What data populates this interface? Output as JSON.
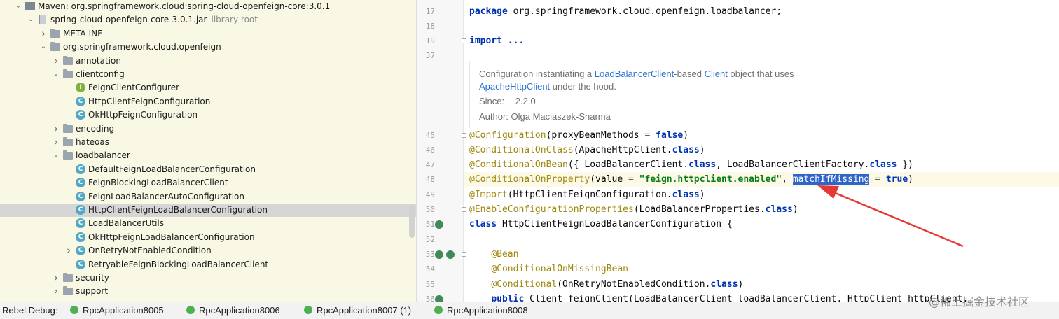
{
  "tree": {
    "rows": [
      {
        "label": "Maven: org.springframework.cloud:spring-cloud-openfeign-core:3.0.1",
        "hint": "",
        "icon": "maven",
        "arrow": "down",
        "level": 0
      },
      {
        "label": "spring-cloud-openfeign-core-3.0.1.jar",
        "hint": "library root",
        "icon": "jar",
        "arrow": "down",
        "level": 1
      },
      {
        "label": "META-INF",
        "hint": "",
        "icon": "folder",
        "arrow": "right",
        "level": 2
      },
      {
        "label": "org.springframework.cloud.openfeign",
        "hint": "",
        "icon": "folder",
        "arrow": "down",
        "level": 2
      },
      {
        "label": "annotation",
        "hint": "",
        "icon": "folder",
        "arrow": "right",
        "level": 3
      },
      {
        "label": "clientconfig",
        "hint": "",
        "icon": "folder",
        "arrow": "down",
        "level": 3
      },
      {
        "label": "FeignClientConfigurer",
        "hint": "",
        "icon": "interface",
        "arrow": "",
        "level": 4
      },
      {
        "label": "HttpClientFeignConfiguration",
        "hint": "",
        "icon": "class",
        "arrow": "",
        "level": 4
      },
      {
        "label": "OkHttpFeignConfiguration",
        "hint": "",
        "icon": "class",
        "arrow": "",
        "level": 4
      },
      {
        "label": "encoding",
        "hint": "",
        "icon": "folder",
        "arrow": "right",
        "level": 3
      },
      {
        "label": "hateoas",
        "hint": "",
        "icon": "folder",
        "arrow": "right",
        "level": 3
      },
      {
        "label": "loadbalancer",
        "hint": "",
        "icon": "folder",
        "arrow": "down",
        "level": 3
      },
      {
        "label": "DefaultFeignLoadBalancerConfiguration",
        "hint": "",
        "icon": "class",
        "arrow": "",
        "level": 4
      },
      {
        "label": "FeignBlockingLoadBalancerClient",
        "hint": "",
        "icon": "class",
        "arrow": "",
        "level": 4
      },
      {
        "label": "FeignLoadBalancerAutoConfiguration",
        "hint": "",
        "icon": "class",
        "arrow": "",
        "level": 4
      },
      {
        "label": "HttpClientFeignLoadBalancerConfiguration",
        "hint": "",
        "icon": "class",
        "arrow": "",
        "level": 4,
        "selected": true
      },
      {
        "label": "LoadBalancerUtils",
        "hint": "",
        "icon": "class",
        "arrow": "",
        "level": 4
      },
      {
        "label": "OkHttpFeignLoadBalancerConfiguration",
        "hint": "",
        "icon": "class",
        "arrow": "",
        "level": 4
      },
      {
        "label": "OnRetryNotEnabledCondition",
        "hint": "",
        "icon": "class",
        "arrow": "right",
        "level": 4
      },
      {
        "label": "RetryableFeignBlockingLoadBalancerClient",
        "hint": "",
        "icon": "class",
        "arrow": "",
        "level": 4
      },
      {
        "label": "security",
        "hint": "",
        "icon": "folder",
        "arrow": "right",
        "level": 3
      },
      {
        "label": "support",
        "hint": "",
        "icon": "folder",
        "arrow": "right",
        "level": 3
      }
    ]
  },
  "editor": {
    "lines": [
      {
        "num": "17",
        "segs": [
          [
            "kw",
            "package"
          ],
          [
            "t",
            " org.springframework.cloud.openfeign.loadbalancer;"
          ]
        ]
      },
      {
        "num": "18",
        "segs": []
      },
      {
        "num": "19",
        "segs": [
          [
            "kw",
            "import"
          ],
          [
            "t",
            " "
          ],
          [
            "kw",
            "..."
          ]
        ],
        "fold": true
      },
      {
        "num": "37",
        "segs": []
      },
      {
        "num": "45",
        "segs": [
          [
            "ann",
            "@Configuration"
          ],
          [
            "t",
            "(proxyBeanMethods = "
          ],
          [
            "kw",
            "false"
          ],
          [
            "t",
            ")"
          ]
        ],
        "fold": true
      },
      {
        "num": "46",
        "segs": [
          [
            "ann",
            "@ConditionalOnClass"
          ],
          [
            "t",
            "(ApacheHttpClient."
          ],
          [
            "kw",
            "class"
          ],
          [
            "t",
            ")"
          ]
        ]
      },
      {
        "num": "47",
        "segs": [
          [
            "ann",
            "@ConditionalOnBean"
          ],
          [
            "t",
            "({ LoadBalancerClient."
          ],
          [
            "kw",
            "class"
          ],
          [
            "t",
            ", LoadBalancerClientFactory."
          ],
          [
            "kw",
            "class"
          ],
          [
            "t",
            " })"
          ]
        ]
      },
      {
        "num": "48",
        "segs": [
          [
            "ann",
            "@ConditionalOnProperty"
          ],
          [
            "t",
            "(value = "
          ],
          [
            "str",
            "\"feign.httpclient.enabled\""
          ],
          [
            "t",
            ", "
          ],
          [
            "sel",
            "matchIfMissing"
          ],
          [
            "t",
            " = "
          ],
          [
            "kw",
            "true"
          ],
          [
            "t",
            ")"
          ]
        ],
        "highlight": true
      },
      {
        "num": "49",
        "segs": [
          [
            "ann",
            "@Import"
          ],
          [
            "t",
            "(HttpClientFeignConfiguration."
          ],
          [
            "kw",
            "class"
          ],
          [
            "t",
            ")"
          ]
        ]
      },
      {
        "num": "50",
        "segs": [
          [
            "ann",
            "@EnableConfigurationProperties"
          ],
          [
            "t",
            "(LoadBalancerProperties."
          ],
          [
            "kw",
            "class"
          ],
          [
            "t",
            ")"
          ]
        ],
        "fold": true
      },
      {
        "num": "51",
        "segs": [
          [
            "kw",
            "class"
          ],
          [
            "t",
            " HttpClientFeignLoadBalancerConfiguration {"
          ]
        ],
        "gutter_icons": 1
      },
      {
        "num": "52",
        "segs": []
      },
      {
        "num": "53",
        "segs": [
          [
            "t",
            "    "
          ],
          [
            "ann",
            "@Bean"
          ]
        ],
        "gutter_icons": 2,
        "fold": true
      },
      {
        "num": "54",
        "segs": [
          [
            "t",
            "    "
          ],
          [
            "ann",
            "@ConditionalOnMissingBean"
          ]
        ]
      },
      {
        "num": "55",
        "segs": [
          [
            "t",
            "    "
          ],
          [
            "ann",
            "@Conditional"
          ],
          [
            "t",
            "(OnRetryNotEnabledCondition."
          ],
          [
            "kw",
            "class"
          ],
          [
            "t",
            ")"
          ]
        ]
      },
      {
        "num": "56",
        "segs": [
          [
            "t",
            "    "
          ],
          [
            "kw",
            "public"
          ],
          [
            "t",
            " Client feignClient(LoadBalancerClient loadBalancerClient, HttpClient httpClient,"
          ]
        ],
        "gutter_icons": 1
      }
    ],
    "doc": {
      "line1": [
        [
          "t",
          "Configuration instantiating a "
        ],
        [
          "link",
          "LoadBalancerClient"
        ],
        [
          "t",
          "-based "
        ],
        [
          "link",
          "Client"
        ],
        [
          "t",
          " object that uses"
        ]
      ],
      "line2": [
        [
          "link",
          "ApacheHttpClient"
        ],
        [
          "t",
          " under the hood."
        ]
      ],
      "since_label": "Since:",
      "since_value": "2.2.0",
      "author": "Author: Olga Maciaszek-Sharma"
    }
  },
  "statusbar": {
    "label": "Rebel Debug:",
    "tabs": [
      "RpcApplication8005",
      "RpcApplication8006",
      "RpcApplication8007 (1)",
      "RpcApplication8008"
    ]
  },
  "watermark": "@稀土掘金技术社区",
  "colors": {
    "tree_bg": "#f8f8e4",
    "selection_bg": "#d6d6d6",
    "keyword": "#0033b3",
    "annotation": "#9e880d",
    "string": "#067d17",
    "selected_word_bg": "#2f65ca",
    "arrow": "#e53935"
  }
}
